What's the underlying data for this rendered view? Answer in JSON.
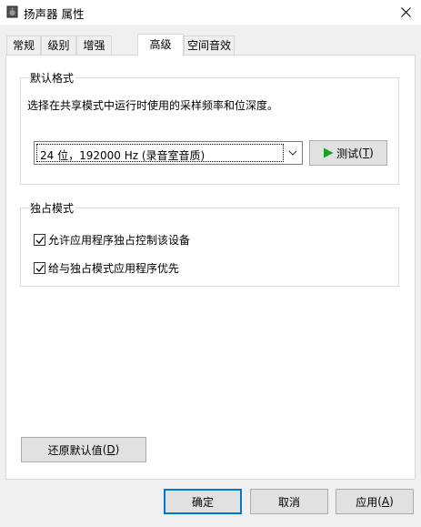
{
  "window": {
    "title": "扬声器 属性",
    "icon": "speaker-icon",
    "close_icon": "close-icon"
  },
  "tabs": [
    {
      "label": "常规",
      "active": false
    },
    {
      "label": "级别",
      "active": false
    },
    {
      "label": "增强",
      "active": false
    },
    {
      "label": "高级",
      "active": true
    },
    {
      "label": "空间音效",
      "active": false
    }
  ],
  "default_format": {
    "legend": "默认格式",
    "description": "选择在共享模式中运行时使用的采样频率和位深度。",
    "selected_format": "24 位，192000 Hz (录音室音质)",
    "test_button": {
      "label": "测试",
      "mnemonic": "T"
    }
  },
  "exclusive_mode": {
    "legend": "独占模式",
    "options": [
      {
        "label": "允许应用程序独占控制该设备",
        "checked": true
      },
      {
        "label": "给与独占模式应用程序优先",
        "checked": true
      }
    ]
  },
  "restore_button": {
    "label": "还原默认值",
    "mnemonic": "D"
  },
  "footer": {
    "ok": "确定",
    "cancel": "取消",
    "apply": "应用",
    "apply_mnemonic": "A"
  },
  "colors": {
    "accent": "#0078d7",
    "play_green": "#1e9e1e"
  }
}
